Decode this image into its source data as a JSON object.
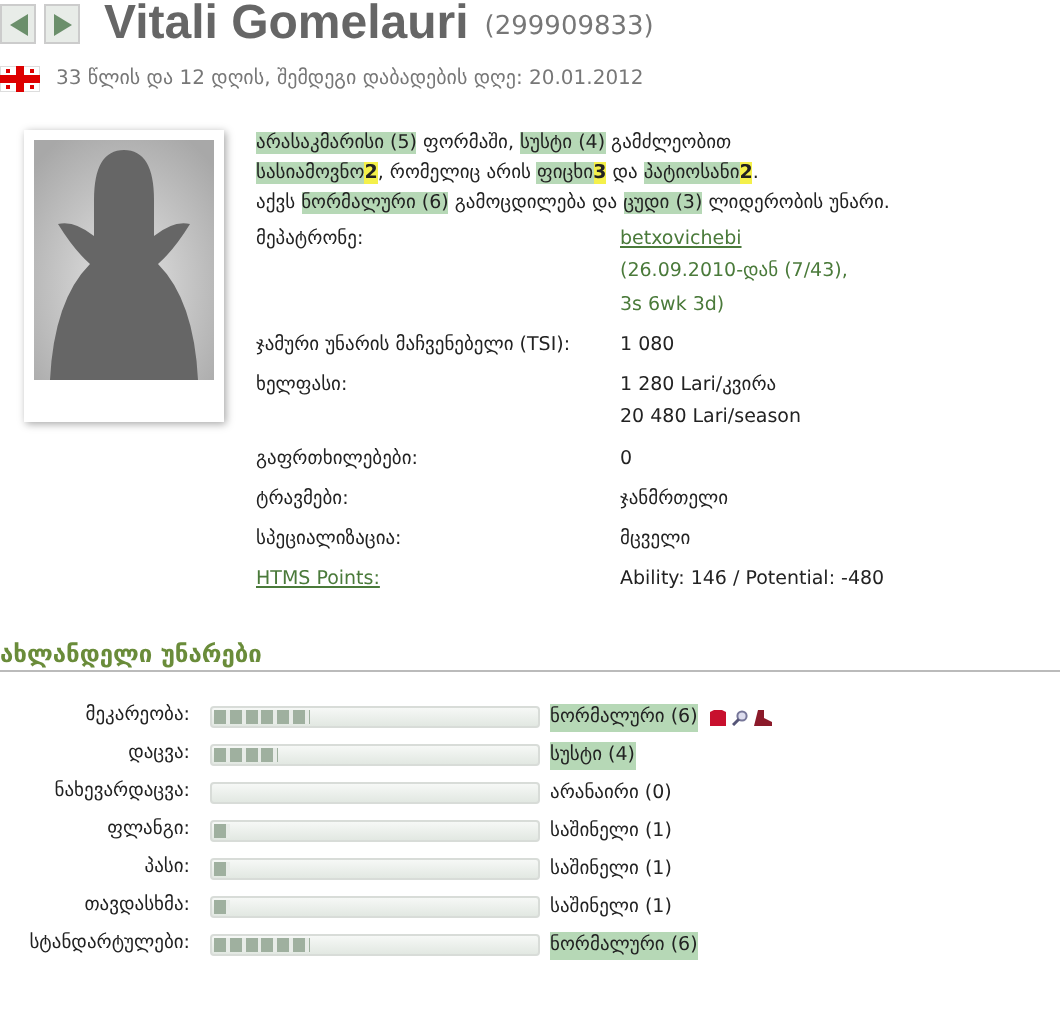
{
  "header": {
    "name": "Vitali Gomelauri",
    "player_id": "(299909833)",
    "subtitle": "33 წლის და 12 დღის, შემდეგი დაბადების დღე: 20.01.2012"
  },
  "summary": [
    [
      {
        "kind": "skill",
        "text": "არასაკმარისი (5)"
      },
      {
        "kind": "plain",
        "text": " ფორმაში, "
      },
      {
        "kind": "skill",
        "text": "სუსტი (4)"
      },
      {
        "kind": "plain",
        "text": " გამძლეობით"
      }
    ],
    [
      {
        "kind": "skill",
        "text": "სასიამოვნო"
      },
      {
        "kind": "number",
        "text": "2"
      },
      {
        "kind": "plain",
        "text": ", რომელიც არის "
      },
      {
        "kind": "skill",
        "text": "ფიცხი"
      },
      {
        "kind": "number",
        "text": "3"
      },
      {
        "kind": "plain",
        "text": " და "
      },
      {
        "kind": "skill",
        "text": "პატიოსანი"
      },
      {
        "kind": "number",
        "text": "2"
      },
      {
        "kind": "plain",
        "text": "."
      }
    ],
    [
      {
        "kind": "plain",
        "text": "აქვს "
      },
      {
        "kind": "skill",
        "text": "ნორმალური (6)"
      },
      {
        "kind": "plain",
        "text": " გამოცდილება და "
      },
      {
        "kind": "skill",
        "text": "ცუდი (3)"
      },
      {
        "kind": "plain",
        "text": " ლიდერობის უნარი."
      }
    ]
  ],
  "details": [
    {
      "label": "მეპატრონე:",
      "link": false,
      "values": [
        "betxovichebi",
        "(26.09.2010-დან (7/43),",
        "3s 6wk 3d)"
      ]
    },
    {
      "label": "ჯამური უნარის მაჩვენებელი (TSI):",
      "link": false,
      "values": [
        "1 080"
      ]
    },
    {
      "label": "ხელფასი:",
      "link": false,
      "values": [
        "1 280 Lari/კვირა",
        "20 480 Lari/season"
      ]
    },
    {
      "label": "გაფრთხილებები:",
      "link": false,
      "values": [
        "0"
      ]
    },
    {
      "label": "ტრავმები:",
      "link": false,
      "values": [
        "ჯანმრთელი"
      ]
    },
    {
      "label": "სპეციალიზაცია:",
      "link": false,
      "values": [
        "მცველი"
      ]
    },
    {
      "label": "HTMS Points:",
      "link": true,
      "values": [
        "Ability: 146 / Potential: -480"
      ]
    }
  ],
  "skills_section": {
    "title": "ახლანდელი უნარები"
  },
  "skills": [
    {
      "label": "მეკარეობა:",
      "level": 0.3,
      "rating": "ნორმალური (6)",
      "highlighted": true,
      "icons": true
    },
    {
      "label": "დაცვა:",
      "level": 0.2,
      "rating": "სუსტი (4)",
      "highlighted": true,
      "icons": false
    },
    {
      "label": "ნახევარდაცვა:",
      "level": 0,
      "rating": "არანაირი (0)",
      "highlighted": false,
      "icons": false
    },
    {
      "label": "ფლანგი:",
      "level": 0.05,
      "rating": "საშინელი (1)",
      "highlighted": false,
      "icons": false
    },
    {
      "label": "პასი:",
      "level": 0.05,
      "rating": "საშინელი (1)",
      "highlighted": false,
      "icons": false
    },
    {
      "label": "თავდასხმა:",
      "level": 0.05,
      "rating": "საშინელი (1)",
      "highlighted": false,
      "icons": false
    },
    {
      "label": "სტანდარტულები:",
      "level": 0.3,
      "rating": "ნორმალური (6)",
      "highlighted": true,
      "icons": false
    }
  ]
}
